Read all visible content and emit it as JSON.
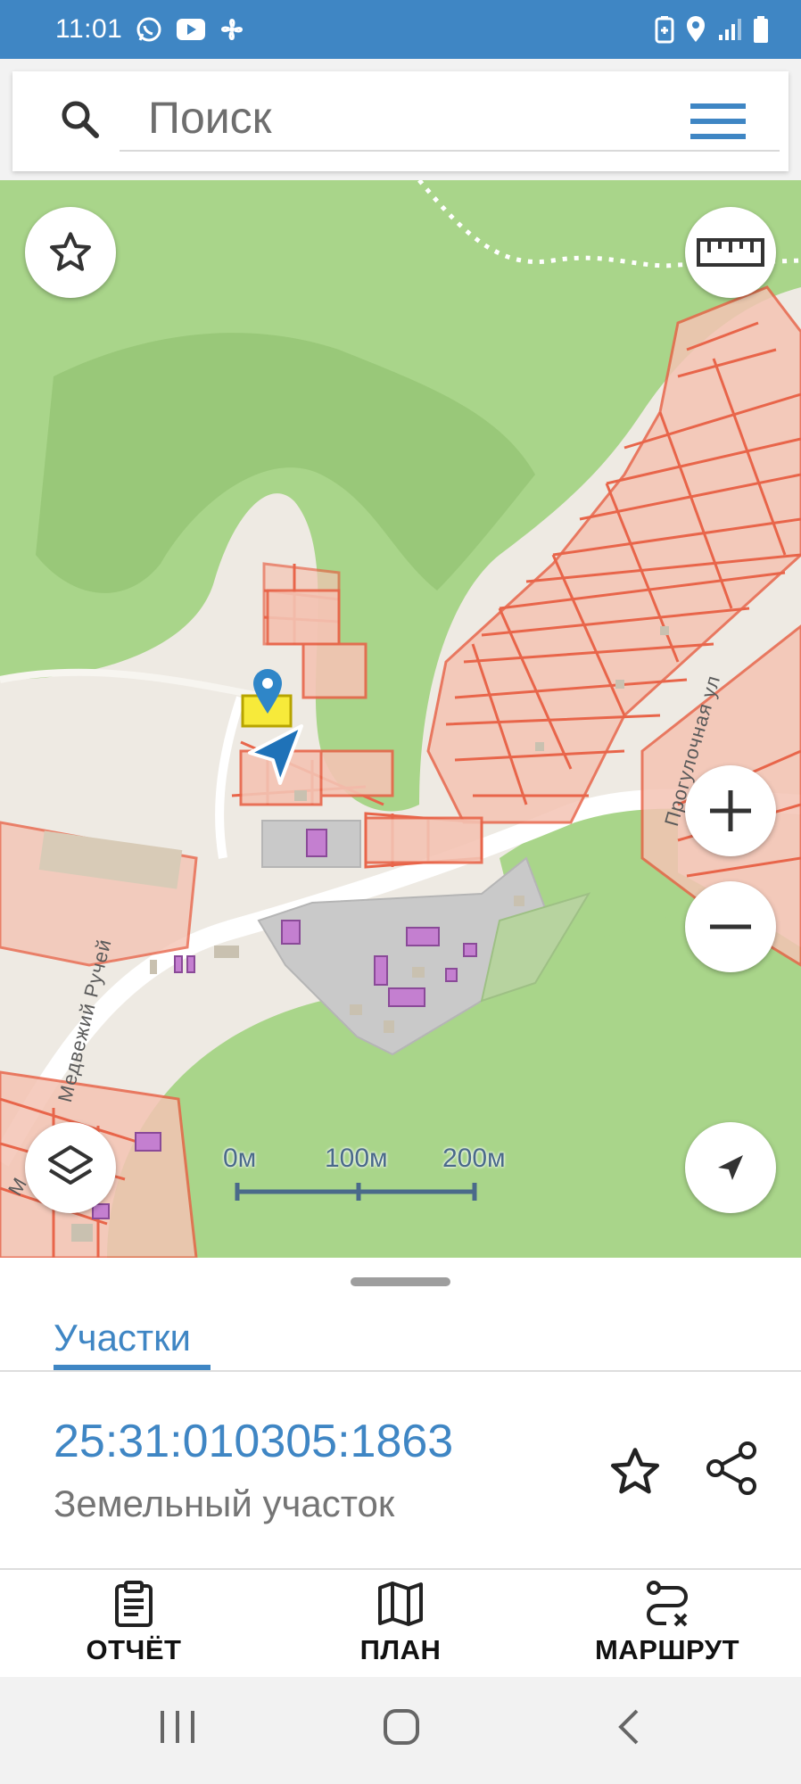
{
  "status_bar": {
    "time": "11:01",
    "left_icons": [
      "whatsapp-icon",
      "youtube-icon",
      "fan-icon"
    ],
    "right_icons": [
      "battery-saver-icon",
      "location-icon",
      "signal-icon",
      "battery-icon"
    ]
  },
  "search": {
    "placeholder": "Поиск",
    "icon": "search-icon",
    "menu_icon": "menu-icon"
  },
  "map": {
    "buttons": [
      "favorites-button",
      "ruler-button",
      "zoom-in-button",
      "zoom-out-button",
      "layers-button",
      "my-location-button"
    ],
    "scale": {
      "labels": [
        "0м",
        "100м",
        "200м"
      ]
    },
    "road_labels": [
      "Прогулочная ул",
      "Медвежий Ручей",
      "М"
    ],
    "colors": {
      "forest": "#a9d58a",
      "forest_dark": "#8fc06e",
      "ground": "#eeeae3",
      "parcel_fill": "#f4c4b4",
      "parcel_stroke": "#e8654a",
      "selected_parcel": "#f7ea3a",
      "marker": "#2f86c8",
      "building": "#c47fd0",
      "industrial": "#c9c9c9"
    }
  },
  "sheet": {
    "tab_label": "Участки",
    "parcel": {
      "cadastral_number": "25:31:010305:1863",
      "type": "Земельный участок"
    },
    "actions": [
      {
        "label": "ОТЧЁТ",
        "icon": "report-icon"
      },
      {
        "label": "ПЛАН",
        "icon": "map-plan-icon"
      },
      {
        "label": "МАРШРУТ",
        "icon": "route-icon"
      }
    ],
    "accent_color": "#3f86c4"
  },
  "navbar": {
    "buttons": [
      "recent-apps-button",
      "home-button",
      "back-button"
    ]
  }
}
